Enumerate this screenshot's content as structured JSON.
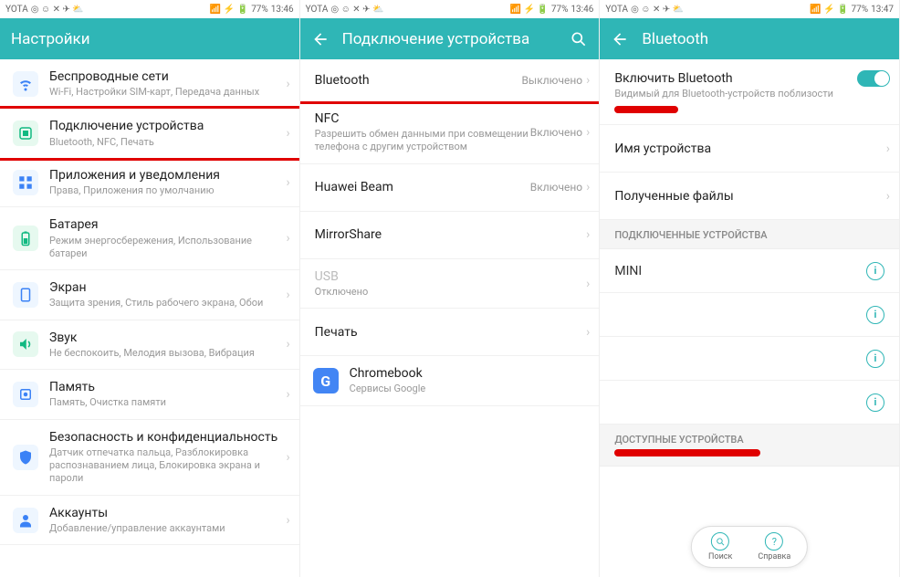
{
  "status": {
    "carrier": "YOTA",
    "battery": "77%",
    "time1": "13:46",
    "time3": "13:47"
  },
  "panel1": {
    "title": "Настройки",
    "items": [
      {
        "title": "Беспроводные сети",
        "sub": "Wi-Fi, Настройки SIM-карт, Передача данных"
      },
      {
        "title": "Подключение устройства",
        "sub": "Bluetooth, NFC, Печать"
      },
      {
        "title": "Приложения и уведомления",
        "sub": "Права, Приложения по умолчанию"
      },
      {
        "title": "Батарея",
        "sub": "Режим энергосбережения, Использование батареи"
      },
      {
        "title": "Экран",
        "sub": "Защита зрения, Стиль рабочего экрана, Обои"
      },
      {
        "title": "Звук",
        "sub": "Не беспокоить, Мелодия вызова, Вибрация"
      },
      {
        "title": "Память",
        "sub": "Память, Очистка памяти"
      },
      {
        "title": "Безопасность и конфиденциальность",
        "sub": "Датчик отпечатка пальца, Разблокировка распознаванием лица, Блокировка экрана и пароли"
      },
      {
        "title": "Аккаунты",
        "sub": "Добавление/управление аккаунтами"
      }
    ]
  },
  "panel2": {
    "title": "Подключение устройства",
    "items": [
      {
        "title": "Bluetooth",
        "side": "Выключено"
      },
      {
        "title": "NFC",
        "sub": "Разрешить обмен данными при совмещении телефона с другим устройством",
        "side": "Включено"
      },
      {
        "title": "Huawei Beam",
        "side": "Включено"
      },
      {
        "title": "MirrorShare"
      },
      {
        "title": "USB",
        "sub": "Отключено",
        "disabled": true
      },
      {
        "title": "Печать"
      },
      {
        "title": "Chromebook",
        "sub": "Сервисы Google",
        "ic": "G"
      }
    ]
  },
  "panel3": {
    "title": "Bluetooth",
    "enable": {
      "title": "Включить Bluetooth",
      "sub": "Видимый для Bluetooth-устройств поблизости"
    },
    "device_name_label": "Имя устройства",
    "received_label": "Полученные файлы",
    "section_paired": "ПОДКЛЮЧЕННЫЕ УСТРОЙСТВА",
    "section_available": "ДОСТУПНЫЕ УСТРОЙСТВА",
    "paired": [
      "MINI",
      "",
      "",
      ""
    ],
    "fab_search": "Поиск",
    "fab_help": "Справка"
  }
}
